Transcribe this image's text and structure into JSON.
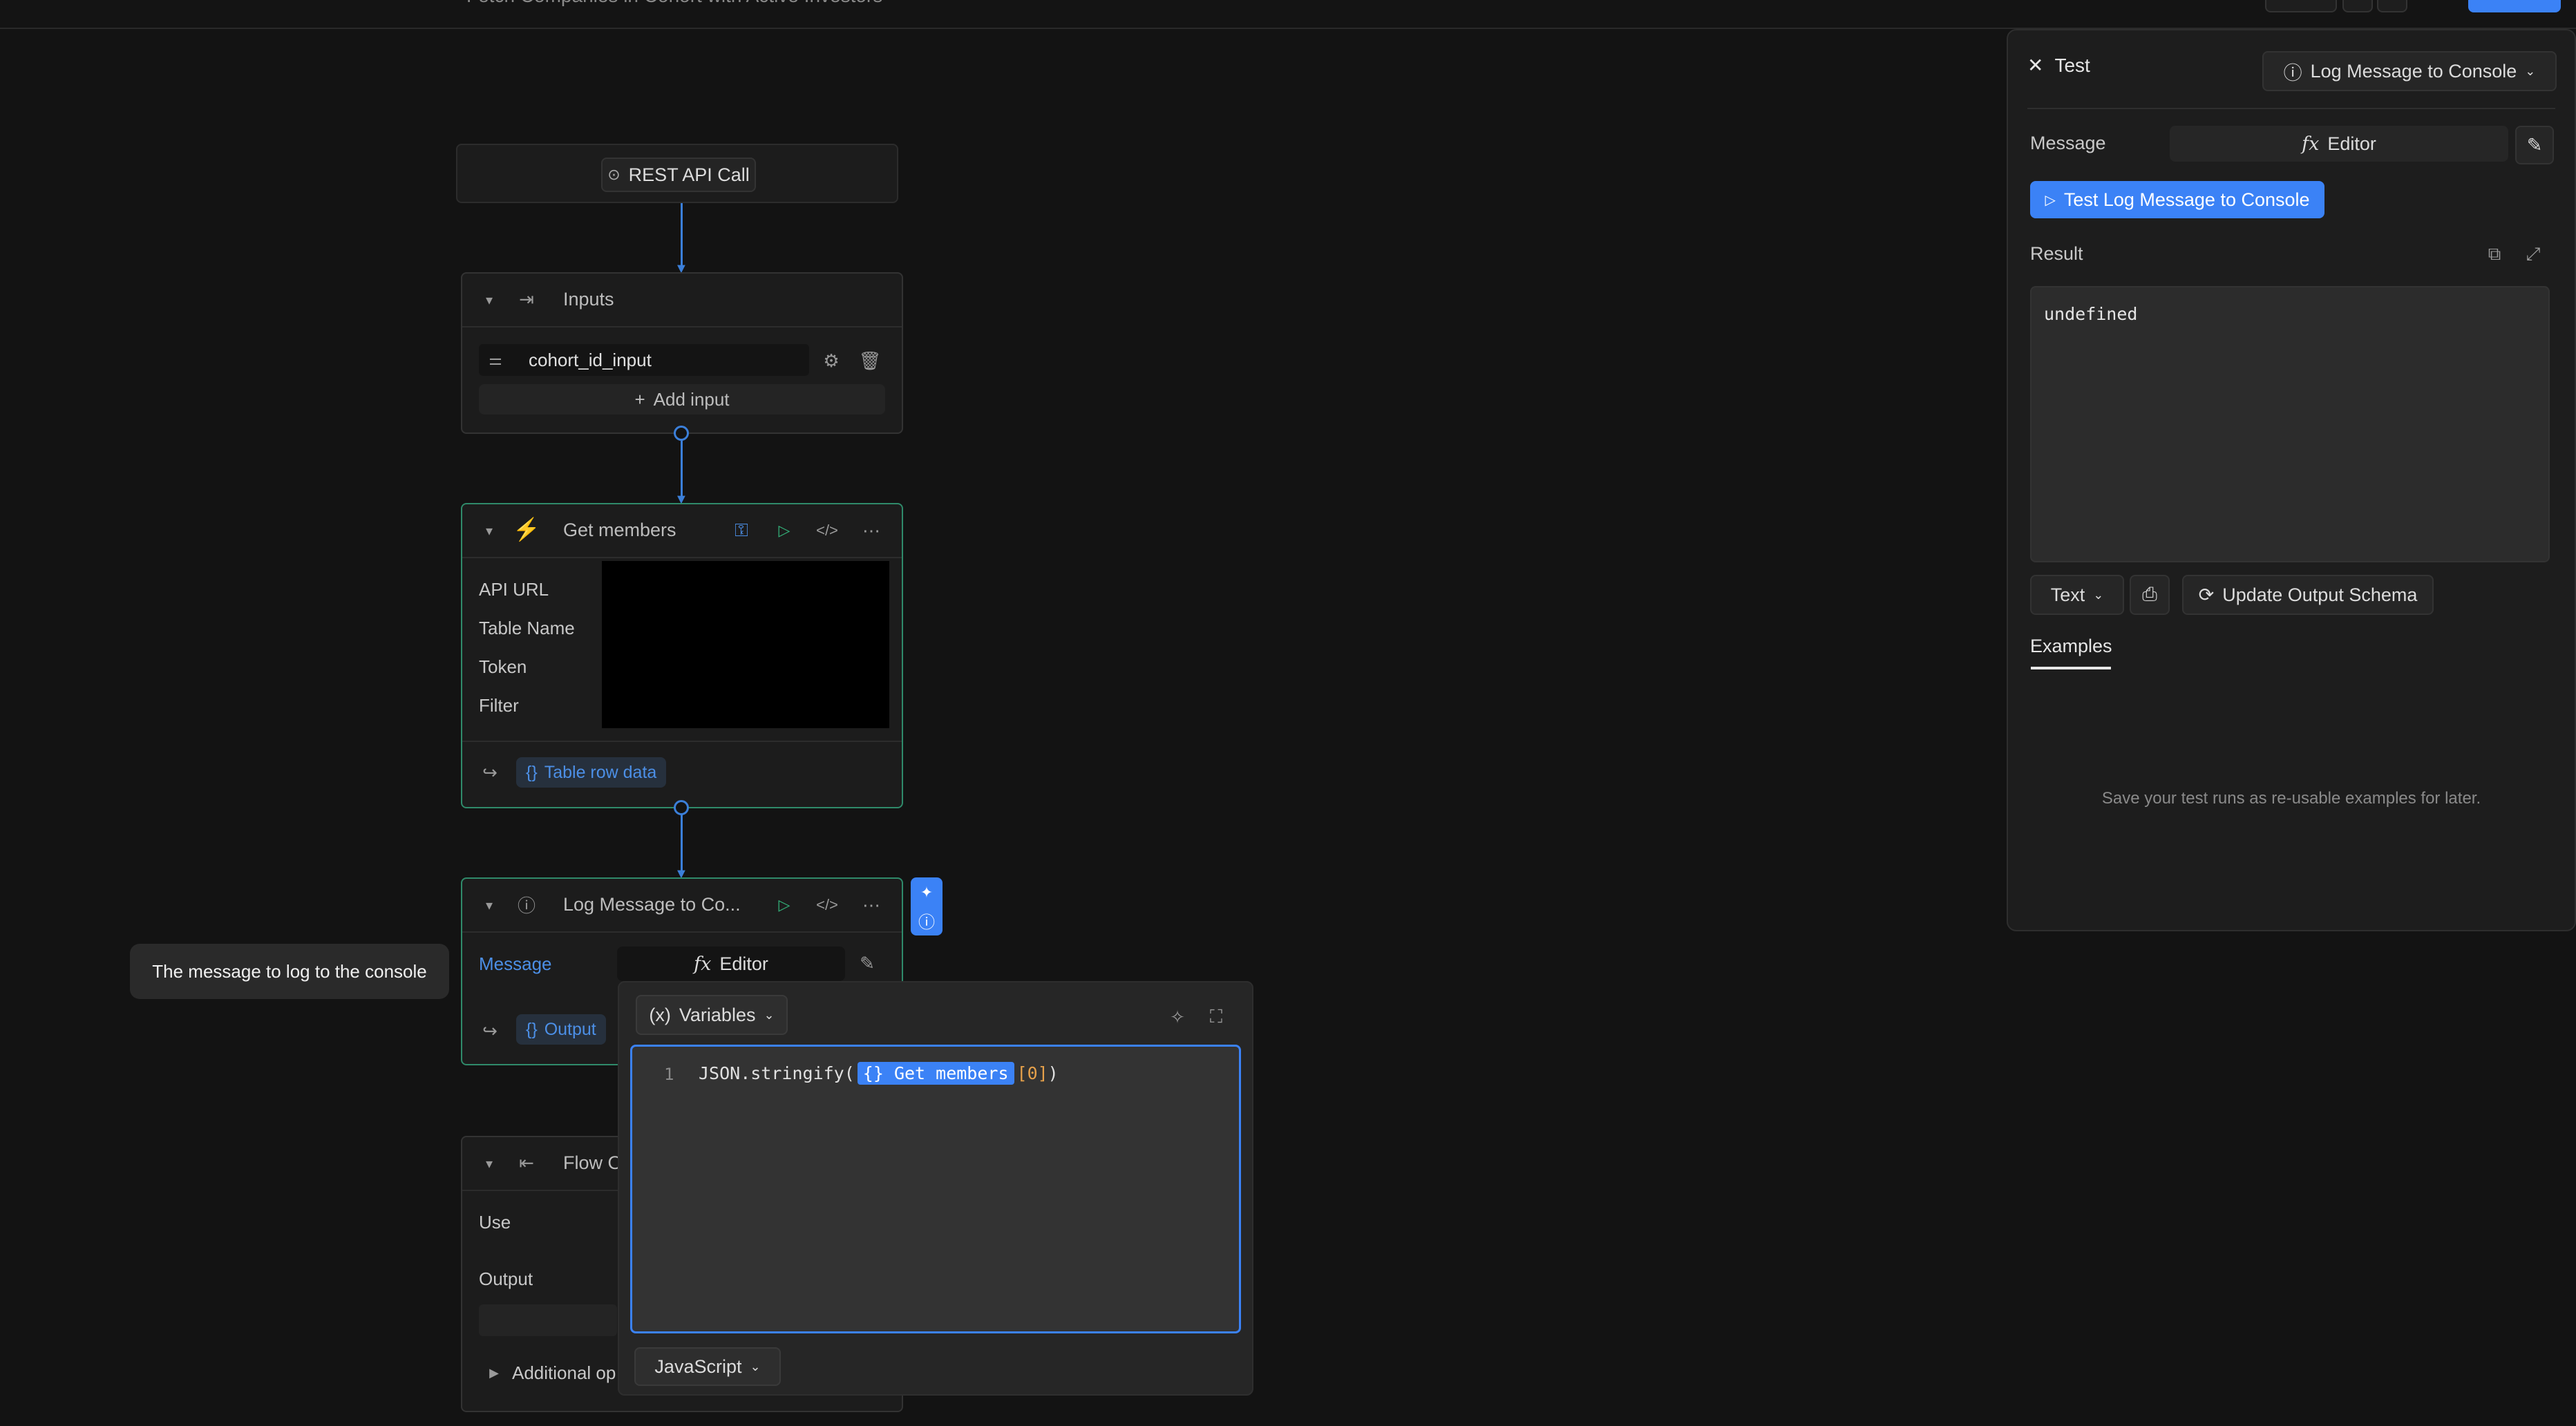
{
  "topbar": {
    "title": "Fetch Companies in Cohort with Active Investors"
  },
  "canvas": {
    "trigger": {
      "label": "REST API Call"
    },
    "inputs_node": {
      "title": "Inputs",
      "input_name": "cohort_id_input",
      "add_label": "Add input"
    },
    "get_members": {
      "title": "Get members",
      "fields": [
        "API URL",
        "Table Name",
        "Token",
        "Filter"
      ],
      "output_label": "Table row data"
    },
    "log_node": {
      "title": "Log Message to Co...",
      "message_label": "Message",
      "editor_label": "Editor",
      "output_label": "Output"
    },
    "flow_output": {
      "title": "Flow O",
      "use_label": "Use",
      "output_label": "Output",
      "additional_label": "Additional op"
    },
    "tooltip": "The message to log to the console"
  },
  "code_popover": {
    "variables_label": "Variables",
    "variables_icon": "(x)",
    "line_number": "1",
    "code_prefix": "JSON.stringify(",
    "code_chip": "Get members",
    "code_index": "[0]",
    "code_suffix": ")",
    "language": "JavaScript"
  },
  "test_panel": {
    "close_label": "Test",
    "step_select": "Log Message to Console",
    "message_label": "Message",
    "editor_label": "Editor",
    "test_button": "Test Log Message to Console",
    "result_label": "Result",
    "result_value": "undefined",
    "format_select": "Text",
    "update_schema": "Update Output Schema",
    "tab_examples": "Examples",
    "empty_examples": "Save your test runs as re-usable examples for later."
  },
  "colors": {
    "accent": "#3b82f6",
    "node_border_active": "#2f8a6a",
    "edge": "#3b7fd9"
  }
}
